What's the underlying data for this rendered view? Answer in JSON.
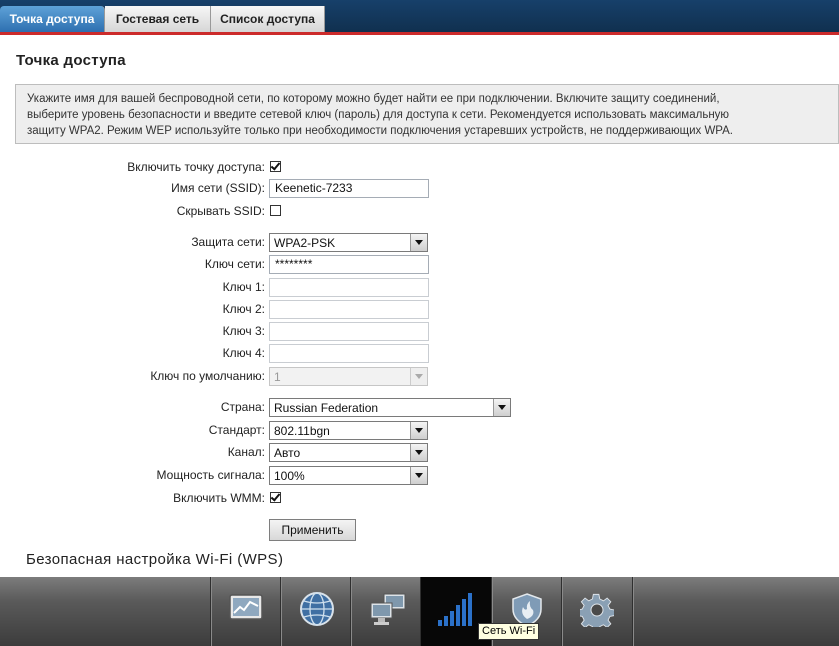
{
  "tabs": [
    {
      "label": "Точка доступа",
      "active": true
    },
    {
      "label": "Гостевая сеть",
      "active": false
    },
    {
      "label": "Список доступа",
      "active": false
    }
  ],
  "page": {
    "title": "Точка доступа",
    "info_lines": [
      "Укажите имя для вашей беспроводной сети, по которому можно будет найти ее при подключении. Включите защиту соединений,",
      "выберите уровень безопасности и введите сетевой ключ (пароль) для доступа к сети. Рекомендуется использовать максимальную",
      "защиту WPA2. Режим WEP используйте только при необходимости подключения устаревших устройств, не поддерживающих WPA."
    ]
  },
  "form": {
    "enable_ap": {
      "label": "Включить точку доступа:",
      "checked": true
    },
    "ssid": {
      "label": "Имя сети (SSID):",
      "value": "Keenetic-7233"
    },
    "hide_ssid": {
      "label": "Скрывать SSID:",
      "checked": false
    },
    "security": {
      "label": "Защита сети:",
      "value": "WPA2-PSK"
    },
    "network_key": {
      "label": "Ключ сети:",
      "value": "********"
    },
    "key1": {
      "label": "Ключ 1:",
      "value": ""
    },
    "key2": {
      "label": "Ключ 2:",
      "value": ""
    },
    "key3": {
      "label": "Ключ 3:",
      "value": ""
    },
    "key4": {
      "label": "Ключ 4:",
      "value": ""
    },
    "default_key": {
      "label": "Ключ по умолчанию:",
      "value": "1",
      "disabled": true
    },
    "country": {
      "label": "Страна:",
      "value": "Russian Federation"
    },
    "standard": {
      "label": "Стандарт:",
      "value": "802.11bgn"
    },
    "channel": {
      "label": "Канал:",
      "value": "Авто"
    },
    "power": {
      "label": "Мощность сигнала:",
      "value": "100%"
    },
    "wmm": {
      "label": "Включить WMM:",
      "checked": true
    },
    "apply_label": "Применить"
  },
  "wps_title": "Безопасная настройка Wi-Fi (WPS)",
  "dock": {
    "items": [
      {
        "name": "monitor-icon"
      },
      {
        "name": "globe-icon"
      },
      {
        "name": "network-icon"
      },
      {
        "name": "wifi-signal-icon",
        "active": true
      },
      {
        "name": "shield-icon"
      },
      {
        "name": "gear-icon"
      }
    ],
    "tooltip": "Сеть Wi-Fi"
  },
  "colors": {
    "header_bg": "#10304f",
    "active_tab": "#3a7fc0",
    "accent_line": "#cc2b2b",
    "dock_bg": "#4a4a4a"
  }
}
